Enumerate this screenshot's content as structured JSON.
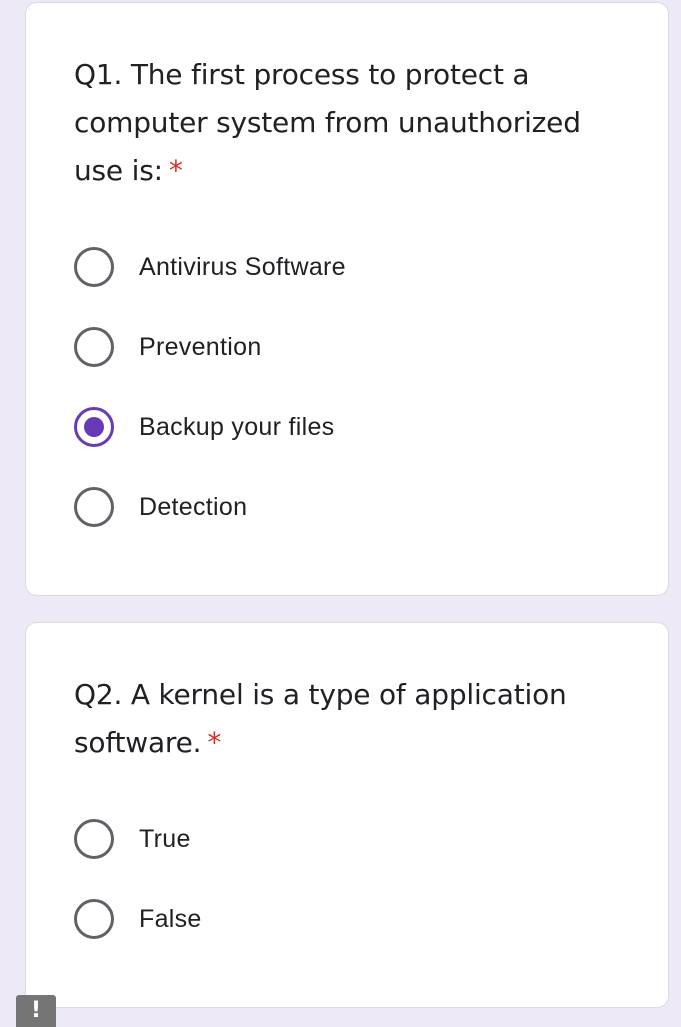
{
  "questions": [
    {
      "text": "Q1. The first process to protect a computer system from unauthorized use is:",
      "required_mark": "*",
      "options": [
        {
          "label": "Antivirus Software",
          "selected": false
        },
        {
          "label": "Prevention",
          "selected": false
        },
        {
          "label": "Backup your files",
          "selected": true
        },
        {
          "label": "Detection",
          "selected": false
        }
      ]
    },
    {
      "text": "Q2. A kernel is a type of application software.",
      "required_mark": "*",
      "options": [
        {
          "label": "True",
          "selected": false
        },
        {
          "label": "False",
          "selected": false
        }
      ]
    }
  ],
  "feedback_button": {
    "glyph": "!"
  },
  "colors": {
    "page_background": "#ede9f7",
    "card_background": "#ffffff",
    "accent": "#673ab7",
    "required": "#d93025",
    "radio_unselected": "#5f6368",
    "text": "#202124"
  }
}
